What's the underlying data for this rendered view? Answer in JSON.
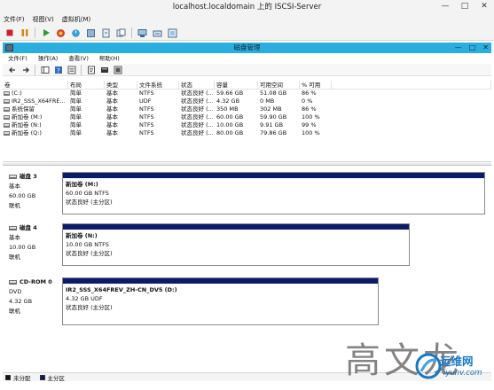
{
  "vm_window": {
    "title": "localhost.localdomain 上的 ISCSI-Server",
    "controls": [
      "—",
      "□",
      "✕"
    ],
    "menu": [
      "文件(F)",
      "视图(V)",
      "虚拟机(M)"
    ]
  },
  "dm_window": {
    "title": "磁盘管理",
    "controls": [
      "—",
      "□",
      "✕"
    ],
    "menu": [
      "文件(F)",
      "操作(A)",
      "查看(V)",
      "帮助(H)"
    ]
  },
  "volume_list": {
    "columns": [
      "卷",
      "布局",
      "类型",
      "文件系统",
      "状态",
      "容量",
      "可用空间",
      "% 可用"
    ],
    "rows": [
      {
        "volume": "(C:)",
        "layout": "简单",
        "type": "基本",
        "fs": "NTFS",
        "status": "状态良好 (...",
        "capacity": "59.66 GB",
        "free": "51.08 GB",
        "pct": "86 %"
      },
      {
        "volume": "IR2_SSS_X64FRE...",
        "layout": "简单",
        "type": "基本",
        "fs": "UDF",
        "status": "状态良好 (...",
        "capacity": "4.32 GB",
        "free": "0 MB",
        "pct": "0 %"
      },
      {
        "volume": "系统保留",
        "layout": "简单",
        "type": "基本",
        "fs": "NTFS",
        "status": "状态良好 (...",
        "capacity": "350 MB",
        "free": "302 MB",
        "pct": "86 %"
      },
      {
        "volume": "新加卷 (M:)",
        "layout": "简单",
        "type": "基本",
        "fs": "NTFS",
        "status": "状态良好 (...",
        "capacity": "60.00 GB",
        "free": "59.90 GB",
        "pct": "100 %"
      },
      {
        "volume": "新加卷 (N:)",
        "layout": "简单",
        "type": "基本",
        "fs": "NTFS",
        "status": "状态良好 (...",
        "capacity": "10.00 GB",
        "free": "9.91 GB",
        "pct": "99 %"
      },
      {
        "volume": "新加卷 (Q:)",
        "layout": "简单",
        "type": "基本",
        "fs": "NTFS",
        "status": "状态良好 (...",
        "capacity": "80.00 GB",
        "free": "79.86 GB",
        "pct": "100 %"
      }
    ]
  },
  "disks": [
    {
      "name": "磁盘 3",
      "type": "基本",
      "size": "60.00 GB",
      "state": "联机",
      "partition": {
        "name": "新加卷  (M:)",
        "detail": "60.00 GB NTFS",
        "status": "状态良好 (主分区)"
      }
    },
    {
      "name": "磁盘 4",
      "type": "基本",
      "size": "10.00 GB",
      "state": "联机",
      "partition": {
        "name": "新加卷  (N:)",
        "detail": "10.00 GB NTFS",
        "status": "状态良好 (主分区)"
      }
    },
    {
      "name": "CD-ROM 0",
      "type": "DVD",
      "size": "4.32 GB",
      "state": "联机",
      "partition": {
        "name": "IR2_SSS_X64FREV_ZH-CN_DV5  (D:)",
        "detail": "4.32 GB UDF",
        "status": "状态良好 (主分区)"
      }
    }
  ],
  "legend": [
    {
      "label": "未分配",
      "color": "#111111"
    },
    {
      "label": "主分区",
      "color": "#0b1a6b"
    }
  ],
  "watermark": {
    "text": "高文龙",
    "brand": "运维网",
    "site": "iyunv.com"
  },
  "colors": {
    "accent_titlebar": "#2aaee0",
    "partition_bar": "#0b1a6b"
  }
}
